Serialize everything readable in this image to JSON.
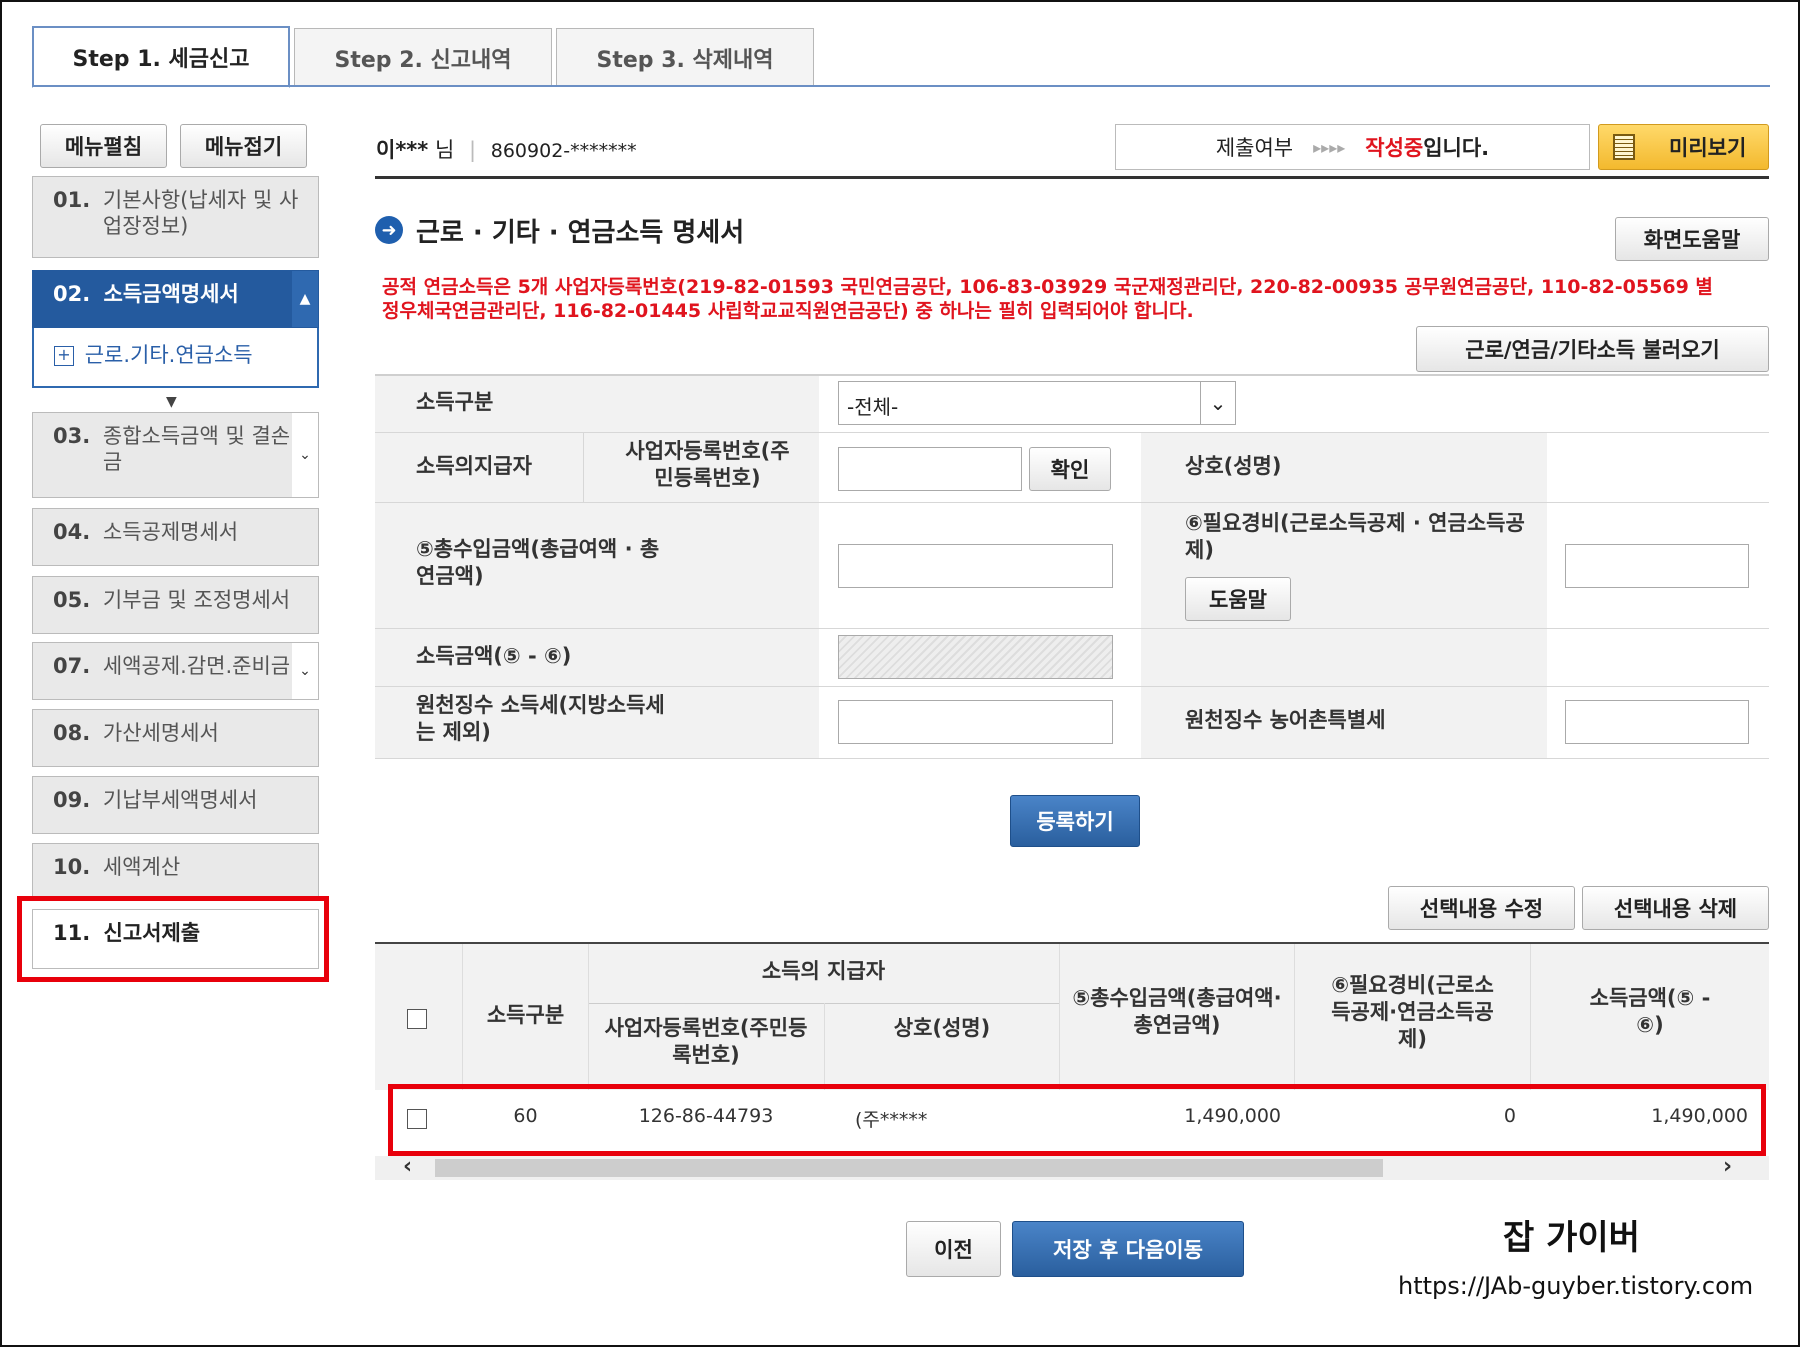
{
  "tabs": [
    {
      "label": "Step 1. 세금신고",
      "active": true
    },
    {
      "label": "Step 2. 신고내역",
      "active": false
    },
    {
      "label": "Step 3. 삭제내역",
      "active": false
    }
  ],
  "sidebar": {
    "expand_label": "메뉴펼침",
    "collapse_label": "메뉴접기",
    "items": [
      {
        "num": "01.",
        "label": "기본사항(납세자 및 사업장정보)"
      },
      {
        "num": "02.",
        "label": "소득금액명세서"
      },
      {
        "sub": "근로.기타.연금소득"
      },
      {
        "num": "03.",
        "label": "종합소득금액 및 결손금"
      },
      {
        "num": "04.",
        "label": "소득공제명세서"
      },
      {
        "num": "05.",
        "label": "기부금 및 조정명세서"
      },
      {
        "num": "07.",
        "label": "세액공제.감면.준비금"
      },
      {
        "num": "08.",
        "label": "가산세명세서"
      },
      {
        "num": "09.",
        "label": "기납부세액명세서"
      },
      {
        "num": "10.",
        "label": "세액계산"
      },
      {
        "num": "11.",
        "label": "신고서제출"
      }
    ]
  },
  "user": {
    "name": "이***",
    "suffix": "님",
    "id": "860902-*******"
  },
  "status": {
    "label": "제출여부",
    "arrows": "▸▸▸▸",
    "state": "작성중",
    "suffix": "입니다."
  },
  "preview_label": "미리보기",
  "section_title": "근로 · 기타 · 연금소득 명세서",
  "help_label": "화면도움말",
  "notice": "공적 연금소득은 5개 사업자등록번호(219-82-01593 국민연금공단, 106-83-03929 국군재정관리단, 220-82-00935 공무원연금공단, 110-82-05569 별정우체국연금관리단, 116-82-01445 사립학교교직원연금공단) 중 하나는 필히 입력되어야 합니다.",
  "load_label": "근로/연금/기타소득 불러오기",
  "form": {
    "income_type_label": "소득구분",
    "income_type_value": "-전체-",
    "payer_label": "소득의지급자",
    "bizno_label": "사업자등록번호(주민등록번호)",
    "confirm_label": "확인",
    "company_label": "상호(성명)",
    "gross_label": "⑤총수입금액(총급여액 · 총연금액)",
    "expense_label": "⑥필요경비(근로소득공제 · 연금소득공제)",
    "expense_help": "도움말",
    "income_label": "소득금액(⑤ - ⑥)",
    "tax_label": "원천징수 소득세(지방소득세는 제외)",
    "rural_label": "원천징수 농어촌특별세"
  },
  "register_label": "등록하기",
  "edit_label": "선택내용 수정",
  "delete_label": "선택내용 삭제",
  "table": {
    "h_type": "소득구분",
    "h_payer": "소득의 지급자",
    "h_bizno": "사업자등록번호(주민등록번호)",
    "h_company": "상호(성명)",
    "h_gross": "⑤총수입금액(총급여액·총연금액)",
    "h_expense": "⑥필요경비(근로소득공제·연금소득공제)",
    "h_income": "소득금액(⑤ - ⑥)",
    "rows": [
      {
        "type": "60",
        "bizno": "126-86-44793",
        "company": "(주*****",
        "gross": "1,490,000",
        "expense": "0",
        "income": "1,490,000"
      }
    ]
  },
  "prev_label": "이전",
  "next_label": "저장 후 다음이동",
  "watermark": {
    "title": "잡 가이버",
    "url": "https://JAb-guyber.tistory.com"
  }
}
